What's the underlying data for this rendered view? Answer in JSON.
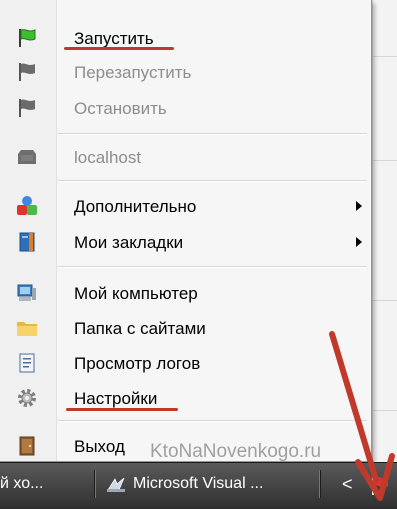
{
  "menu": {
    "items": [
      {
        "label": "Запустить",
        "icon": "green-flag-icon",
        "disabled": false
      },
      {
        "label": "Перезапустить",
        "icon": "gray-flag-icon",
        "disabled": true
      },
      {
        "label": "Остановить",
        "icon": "gray-flag-icon",
        "disabled": true
      },
      {
        "label": "localhost",
        "icon": "server-icon",
        "disabled": true
      },
      {
        "label": "Дополнительно",
        "icon": "shapes-icon",
        "disabled": false,
        "submenu": true
      },
      {
        "label": "Мои закладки",
        "icon": "bookmarks-icon",
        "disabled": false,
        "submenu": true
      },
      {
        "label": "Мой компьютер",
        "icon": "computer-icon",
        "disabled": false
      },
      {
        "label": "Папка с сайтами",
        "icon": "folder-icon",
        "disabled": false
      },
      {
        "label": "Просмотр логов",
        "icon": "log-icon",
        "disabled": false
      },
      {
        "label": "Настройки",
        "icon": "gear-icon",
        "disabled": false
      },
      {
        "label": "Выход",
        "icon": "exit-door-icon",
        "disabled": false
      }
    ],
    "watermark": "KtoNaNovenkogo.ru"
  },
  "colors": {
    "highlight_underline": "#c0392b",
    "arrow": "#c0392b",
    "taskbar": "#3a3a3a"
  },
  "taskbar": {
    "item1": "й хо...",
    "item2": "Microsoft Visual ...",
    "chevron": "<"
  }
}
